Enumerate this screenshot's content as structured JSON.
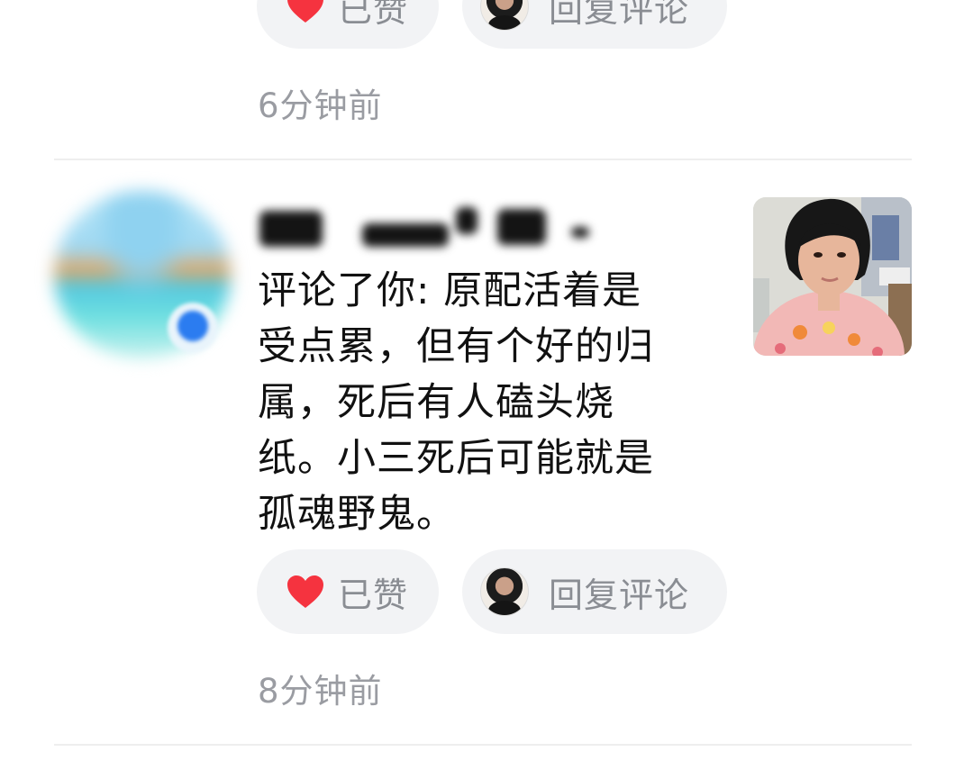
{
  "comments": [
    {
      "like_label": "已赞",
      "reply_label": "回复评论",
      "time": "6分钟前"
    },
    {
      "name": "",
      "action": "评论了你:",
      "text_lines": [
        "评论了你: 原配活着是",
        "受点累，但有个好的归",
        "属，死后有人磕头烧",
        "纸。小三死后可能就是",
        "孤魂野鬼。"
      ],
      "like_label": "已赞",
      "reply_label": "回复评论",
      "time": "8分钟前"
    }
  ],
  "icons": {
    "like": "heart-icon",
    "reply_avatar": "avatar"
  },
  "colors": {
    "heart": "#f5333f",
    "pill_bg": "#f2f3f5",
    "secondary_text": "#8a8d93"
  }
}
